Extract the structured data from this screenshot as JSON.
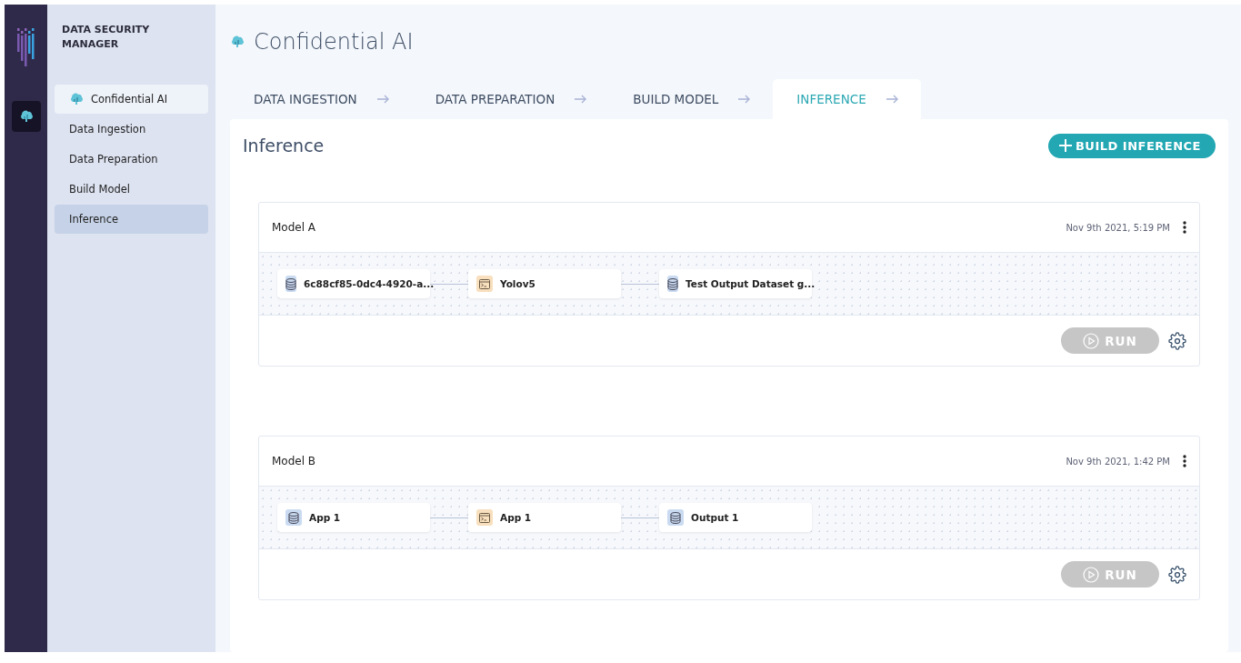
{
  "app": {
    "title": "DATA SECURITY MANAGER"
  },
  "sidebar": {
    "items": [
      {
        "label": "Confidential AI",
        "kind": "header"
      },
      {
        "label": "Data Ingestion",
        "kind": "link",
        "selected": false
      },
      {
        "label": "Data Preparation",
        "kind": "link",
        "selected": false
      },
      {
        "label": "Build Model",
        "kind": "link",
        "selected": false
      },
      {
        "label": "Inference",
        "kind": "link",
        "selected": true
      }
    ]
  },
  "page": {
    "title": "Confidential AI"
  },
  "tabs": [
    {
      "label": "DATA INGESTION",
      "selected": false
    },
    {
      "label": "DATA PREPARATION",
      "selected": false
    },
    {
      "label": "BUILD MODEL",
      "selected": false
    },
    {
      "label": "INFERENCE",
      "selected": true
    }
  ],
  "section": {
    "title": "Inference",
    "action": "BUILD INFERENCE"
  },
  "models": [
    {
      "name": "Model A",
      "date": "Nov 9th 2021, 5:19 PM",
      "run": {
        "label": "RUN",
        "disabled": true
      },
      "nodes": [
        {
          "kind": "dataset",
          "label": "6c88cf85-0dc4-4920-a..."
        },
        {
          "kind": "app",
          "label": "Yolov5"
        },
        {
          "kind": "dataset",
          "label": "Test Output Dataset g..."
        }
      ]
    },
    {
      "name": "Model B",
      "date": "Nov 9th 2021, 1:42 PM",
      "run": {
        "label": "RUN",
        "disabled": true
      },
      "nodes": [
        {
          "kind": "dataset",
          "label": "App 1"
        },
        {
          "kind": "app",
          "label": "App 1"
        },
        {
          "kind": "dataset",
          "label": "Output 1"
        }
      ]
    }
  ]
}
